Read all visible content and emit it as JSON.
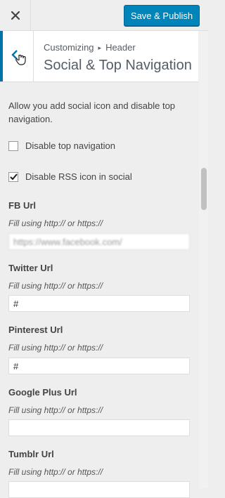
{
  "topbar": {
    "save_label": "Save & Publish"
  },
  "header": {
    "breadcrumb_parent": "Customizing",
    "breadcrumb_current": "Header",
    "title": "Social & Top Navigation"
  },
  "description": "Allow you add social icon and disable top navigation.",
  "checkboxes": [
    {
      "label": "Disable top navigation",
      "checked": false
    },
    {
      "label": "Disable RSS icon in social",
      "checked": true
    }
  ],
  "fields": [
    {
      "label": "FB Url",
      "hint": "Fill using http:// or https://",
      "value": "https://www.facebook.com/"
    },
    {
      "label": "Twitter Url",
      "hint": "Fill using http:// or https://",
      "value": "#"
    },
    {
      "label": "Pinterest Url",
      "hint": "Fill using http:// or https://",
      "value": "#"
    },
    {
      "label": "Google Plus Url",
      "hint": "Fill using http:// or https://",
      "value": ""
    },
    {
      "label": "Tumblr Url",
      "hint": "Fill using http:// or https://",
      "value": ""
    }
  ],
  "colors": {
    "primary": "#0085ba",
    "accent_border": "#0073aa",
    "background": "#eeeeee"
  }
}
